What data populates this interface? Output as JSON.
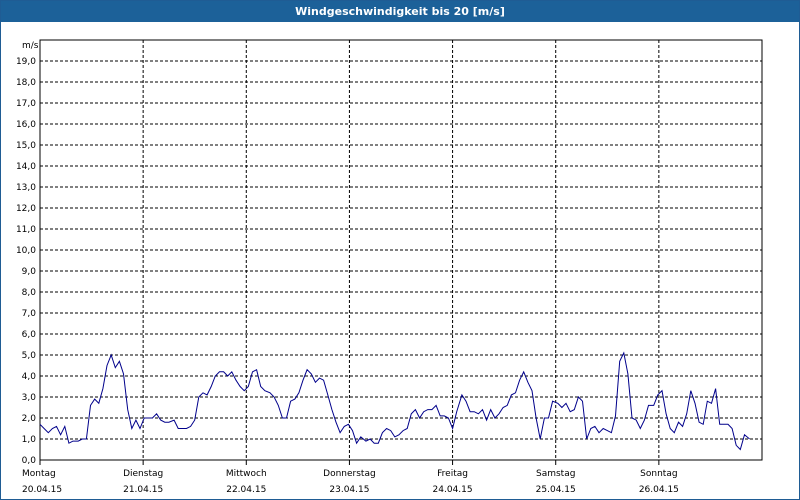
{
  "window": {
    "title": "Windgeschwindigkeit bis 20 [m/s]"
  },
  "colors": {
    "title_bar": "#1c6199",
    "line": "#00008b",
    "grid": "#000000"
  },
  "chart_data": {
    "type": "line",
    "title": "Windgeschwindigkeit bis 20 [m/s]",
    "ylabel": "m/s",
    "xlabel": "",
    "ylim": [
      0,
      20
    ],
    "yticks": [
      "0,0",
      "1,0",
      "2,0",
      "3,0",
      "4,0",
      "5,0",
      "6,0",
      "7,0",
      "8,0",
      "9,0",
      "10,0",
      "11,0",
      "12,0",
      "13,0",
      "14,0",
      "15,0",
      "16,0",
      "17,0",
      "18,0",
      "19,0"
    ],
    "grid": true,
    "xlim": [
      0,
      7
    ],
    "x_axis": [
      {
        "day": "Montag",
        "date": "20.04.15"
      },
      {
        "day": "Dienstag",
        "date": "21.04.15"
      },
      {
        "day": "Mittwoch",
        "date": "22.04.15"
      },
      {
        "day": "Donnerstag",
        "date": "23.04.15"
      },
      {
        "day": "Freitag",
        "date": "24.04.15"
      },
      {
        "day": "Samstag",
        "date": "25.04.15"
      },
      {
        "day": "Sonntag",
        "date": "26.04.15"
      }
    ],
    "series": [
      {
        "values": [
          [
            0.0,
            1.7
          ],
          [
            0.04,
            1.5
          ],
          [
            0.08,
            1.3
          ],
          [
            0.12,
            1.5
          ],
          [
            0.16,
            1.6
          ],
          [
            0.2,
            1.2
          ],
          [
            0.24,
            1.6
          ],
          [
            0.28,
            0.8
          ],
          [
            0.32,
            0.9
          ],
          [
            0.37,
            0.9
          ],
          [
            0.41,
            1.0
          ],
          [
            0.45,
            1.0
          ],
          [
            0.49,
            2.6
          ],
          [
            0.53,
            2.9
          ],
          [
            0.57,
            2.7
          ],
          [
            0.61,
            3.4
          ],
          [
            0.65,
            4.5
          ],
          [
            0.69,
            5.0
          ],
          [
            0.73,
            4.4
          ],
          [
            0.77,
            4.7
          ],
          [
            0.81,
            4.1
          ],
          [
            0.85,
            2.4
          ],
          [
            0.89,
            1.5
          ],
          [
            0.93,
            1.9
          ],
          [
            0.97,
            1.5
          ],
          [
            1.01,
            2.0
          ],
          [
            1.05,
            2.0
          ],
          [
            1.09,
            2.0
          ],
          [
            1.13,
            2.2
          ],
          [
            1.17,
            1.9
          ],
          [
            1.21,
            1.8
          ],
          [
            1.25,
            1.8
          ],
          [
            1.3,
            1.9
          ],
          [
            1.34,
            1.5
          ],
          [
            1.38,
            1.5
          ],
          [
            1.42,
            1.5
          ],
          [
            1.46,
            1.6
          ],
          [
            1.5,
            1.9
          ],
          [
            1.54,
            3.0
          ],
          [
            1.58,
            3.2
          ],
          [
            1.62,
            3.1
          ],
          [
            1.66,
            3.5
          ],
          [
            1.7,
            4.0
          ],
          [
            1.74,
            4.2
          ],
          [
            1.78,
            4.2
          ],
          [
            1.82,
            4.0
          ],
          [
            1.86,
            4.2
          ],
          [
            1.9,
            3.8
          ],
          [
            1.94,
            3.5
          ],
          [
            1.98,
            3.3
          ],
          [
            2.02,
            3.5
          ],
          [
            2.06,
            4.2
          ],
          [
            2.1,
            4.3
          ],
          [
            2.14,
            3.5
          ],
          [
            2.18,
            3.3
          ],
          [
            2.23,
            3.2
          ],
          [
            2.27,
            3.0
          ],
          [
            2.31,
            2.6
          ],
          [
            2.35,
            2.0
          ],
          [
            2.39,
            2.0
          ],
          [
            2.43,
            2.8
          ],
          [
            2.47,
            2.9
          ],
          [
            2.51,
            3.2
          ],
          [
            2.55,
            3.8
          ],
          [
            2.59,
            4.3
          ],
          [
            2.63,
            4.1
          ],
          [
            2.67,
            3.7
          ],
          [
            2.71,
            3.9
          ],
          [
            2.75,
            3.8
          ],
          [
            2.79,
            3.1
          ],
          [
            2.83,
            2.4
          ],
          [
            2.87,
            1.8
          ],
          [
            2.91,
            1.3
          ],
          [
            2.95,
            1.6
          ],
          [
            2.99,
            1.7
          ],
          [
            3.03,
            1.4
          ],
          [
            3.07,
            0.8
          ],
          [
            3.11,
            1.1
          ],
          [
            3.16,
            0.9
          ],
          [
            3.2,
            1.0
          ],
          [
            3.24,
            0.8
          ],
          [
            3.28,
            0.8
          ],
          [
            3.32,
            1.3
          ],
          [
            3.36,
            1.5
          ],
          [
            3.4,
            1.4
          ],
          [
            3.44,
            1.1
          ],
          [
            3.48,
            1.2
          ],
          [
            3.52,
            1.4
          ],
          [
            3.56,
            1.5
          ],
          [
            3.6,
            2.2
          ],
          [
            3.64,
            2.4
          ],
          [
            3.68,
            2.0
          ],
          [
            3.72,
            2.3
          ],
          [
            3.76,
            2.4
          ],
          [
            3.8,
            2.4
          ],
          [
            3.84,
            2.6
          ],
          [
            3.88,
            2.1
          ],
          [
            3.92,
            2.1
          ],
          [
            3.96,
            2.0
          ],
          [
            4.0,
            1.5
          ],
          [
            4.04,
            2.3
          ],
          [
            4.09,
            3.1
          ],
          [
            4.13,
            2.8
          ],
          [
            4.17,
            2.3
          ],
          [
            4.21,
            2.3
          ],
          [
            4.25,
            2.2
          ],
          [
            4.29,
            2.4
          ],
          [
            4.33,
            1.9
          ],
          [
            4.37,
            2.4
          ],
          [
            4.41,
            2.0
          ],
          [
            4.45,
            2.2
          ],
          [
            4.49,
            2.5
          ],
          [
            4.53,
            2.6
          ],
          [
            4.57,
            3.1
          ],
          [
            4.61,
            3.2
          ],
          [
            4.65,
            3.8
          ],
          [
            4.69,
            4.2
          ],
          [
            4.73,
            3.7
          ],
          [
            4.77,
            3.3
          ],
          [
            4.81,
            2.0
          ],
          [
            4.85,
            1.0
          ],
          [
            4.89,
            2.0
          ],
          [
            4.93,
            2.0
          ],
          [
            4.97,
            2.8
          ],
          [
            5.02,
            2.7
          ],
          [
            5.06,
            2.5
          ],
          [
            5.1,
            2.7
          ],
          [
            5.14,
            2.3
          ],
          [
            5.18,
            2.4
          ],
          [
            5.22,
            3.0
          ],
          [
            5.26,
            2.8
          ],
          [
            5.3,
            1.0
          ],
          [
            5.34,
            1.5
          ],
          [
            5.38,
            1.6
          ],
          [
            5.42,
            1.3
          ],
          [
            5.46,
            1.5
          ],
          [
            5.5,
            1.4
          ],
          [
            5.54,
            1.3
          ],
          [
            5.58,
            2.1
          ],
          [
            5.62,
            4.7
          ],
          [
            5.66,
            5.1
          ],
          [
            5.7,
            4.1
          ],
          [
            5.74,
            2.0
          ],
          [
            5.78,
            1.9
          ],
          [
            5.82,
            1.5
          ],
          [
            5.86,
            1.9
          ],
          [
            5.9,
            2.6
          ],
          [
            5.95,
            2.6
          ],
          [
            5.99,
            3.1
          ],
          [
            6.03,
            3.3
          ],
          [
            6.07,
            2.2
          ],
          [
            6.11,
            1.5
          ],
          [
            6.15,
            1.3
          ],
          [
            6.19,
            1.8
          ],
          [
            6.23,
            1.6
          ],
          [
            6.27,
            2.2
          ],
          [
            6.31,
            3.3
          ],
          [
            6.35,
            2.7
          ],
          [
            6.39,
            1.8
          ],
          [
            6.43,
            1.7
          ],
          [
            6.47,
            2.8
          ],
          [
            6.51,
            2.7
          ],
          [
            6.55,
            3.4
          ],
          [
            6.59,
            1.7
          ],
          [
            6.63,
            1.7
          ],
          [
            6.67,
            1.7
          ],
          [
            6.71,
            1.5
          ],
          [
            6.75,
            0.7
          ],
          [
            6.79,
            0.5
          ],
          [
            6.83,
            1.2
          ],
          [
            6.88,
            1.0
          ]
        ]
      }
    ]
  }
}
